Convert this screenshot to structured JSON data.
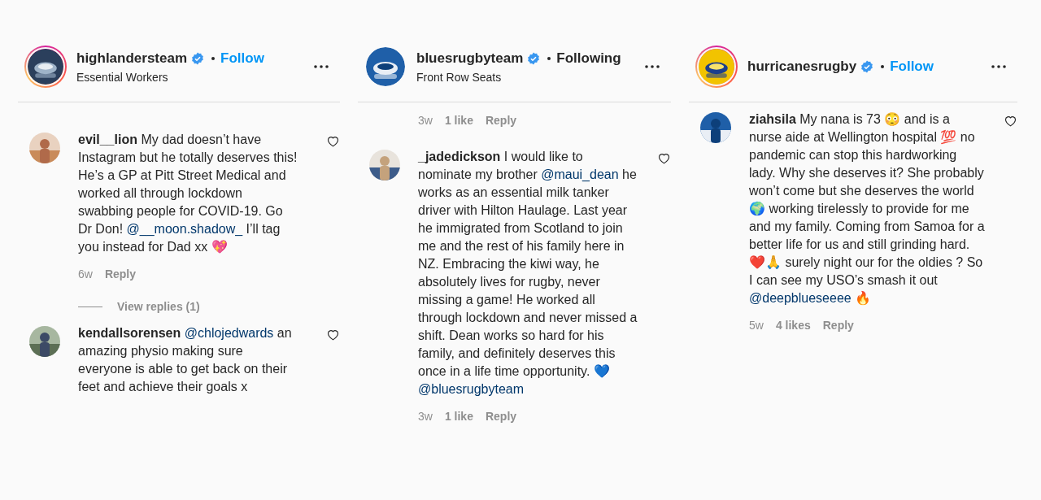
{
  "posts": [
    {
      "username": "highlandersteam",
      "verified": true,
      "has_story": true,
      "follow": {
        "label": "Follow",
        "following": false
      },
      "subtitle": "Essential Workers",
      "comments": [
        {
          "username": "evil__lion",
          "body": [
            {
              "kind": "text",
              "text": "My dad doesn’t have Instagram but he totally deserves this! He’s a GP at Pitt Street Medical and worked all through lockdown swabbing people for COVID-19. Go Dr Don! "
            },
            {
              "kind": "mention",
              "text": "@__moon.shadow_"
            },
            {
              "kind": "text",
              "text": " I’ll tag you instead for Dad xx 💖"
            }
          ],
          "meta": {
            "time": "6w",
            "reply": "Reply"
          },
          "view_replies": "View replies (1)"
        },
        {
          "username": "kendallsorensen",
          "body": [
            {
              "kind": "mention",
              "text": "@chlojedwards"
            },
            {
              "kind": "text",
              "text": " an amazing physio making sure everyone is able to get back on their feet and achieve their goals x"
            }
          ]
        }
      ]
    },
    {
      "username": "bluesrugbyteam",
      "verified": true,
      "has_story": false,
      "follow": {
        "label": "Following",
        "following": true
      },
      "subtitle": "Front Row Seats",
      "top_meta": {
        "time": "3w",
        "likes": "1 like",
        "reply": "Reply"
      },
      "comments": [
        {
          "username": "_jadedickson",
          "body": [
            {
              "kind": "text",
              "text": "I would like to nominate my brother "
            },
            {
              "kind": "mention",
              "text": "@maui_dean"
            },
            {
              "kind": "text",
              "text": " he works as an essential milk tanker driver with Hilton Haulage. Last year he immigrated from Scotland to join me and the rest of his family here in NZ. Embracing the kiwi way, he absolutely lives for rugby, never missing a game! He worked all through lockdown and never missed a shift. Dean works so hard for his family, and definitely deserves this once in a life time opportunity. 💙 "
            },
            {
              "kind": "mention",
              "text": "@bluesrugbyteam"
            }
          ],
          "meta": {
            "time": "3w",
            "likes": "1 like",
            "reply": "Reply"
          }
        }
      ]
    },
    {
      "username": "hurricanesrugby",
      "verified": true,
      "has_story": true,
      "follow": {
        "label": "Follow",
        "following": false
      },
      "comments": [
        {
          "username": "ziahsila",
          "body": [
            {
              "kind": "text",
              "text": "My nana is 73 😳 and is a nurse aide at Wellington hospital 💯 no pandemic can stop this hardworking lady. Why she deserves it? She probably won’t come but she deserves the world 🌍 working tirelessly to provide for me and my family. Coming from Samoa for a better life for us and still grinding hard. ❤️🙏 surely night our for the oldies ? So I can see my USO’s smash it out "
            },
            {
              "kind": "mention",
              "text": "@deepblueseeee"
            },
            {
              "kind": "text",
              "text": " 🔥"
            }
          ],
          "meta": {
            "time": "5w",
            "likes": "4 likes",
            "reply": "Reply"
          }
        }
      ]
    }
  ]
}
